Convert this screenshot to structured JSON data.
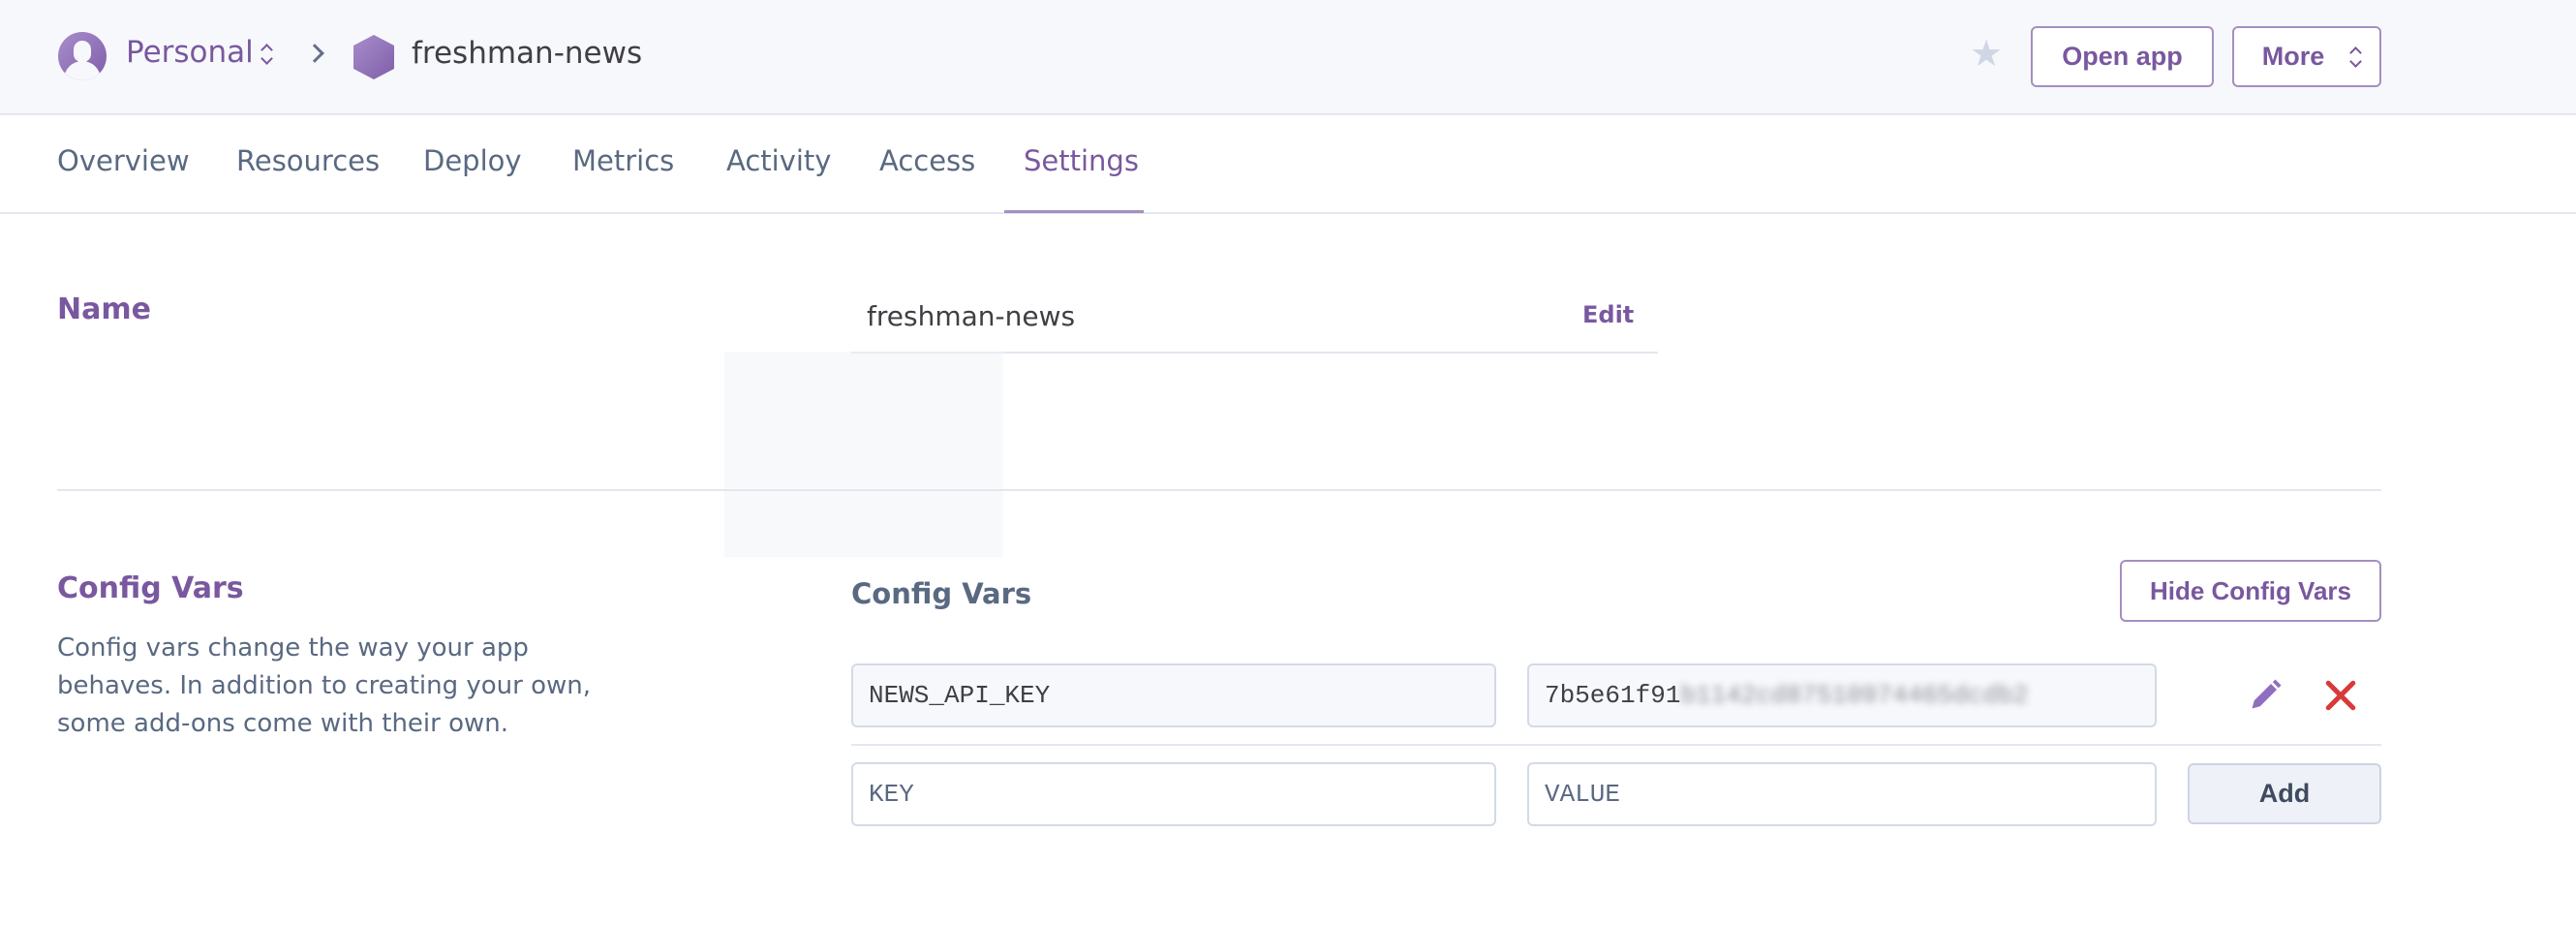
{
  "header": {
    "account_label": "Personal",
    "app_name": "freshman-news",
    "open_app_label": "Open app",
    "more_label": "More"
  },
  "tabs": [
    {
      "label": "Overview",
      "active": false
    },
    {
      "label": "Resources",
      "active": false
    },
    {
      "label": "Deploy",
      "active": false
    },
    {
      "label": "Metrics",
      "active": false
    },
    {
      "label": "Activity",
      "active": false
    },
    {
      "label": "Access",
      "active": false
    },
    {
      "label": "Settings",
      "active": true
    }
  ],
  "name_section": {
    "title": "Name",
    "value": "freshman-news",
    "edit_label": "Edit"
  },
  "config_vars_section": {
    "title": "Config Vars",
    "description": "Config vars change the way your app behaves. In addition to creating your own, some add-ons come with their own.",
    "heading": "Config Vars",
    "hide_button_label": "Hide Config Vars",
    "vars": [
      {
        "key": "NEWS_API_KEY",
        "value_visible": "7b5e61f91",
        "value_redacted": "b1142cd87510974465dcdb2"
      }
    ],
    "new_var": {
      "key_placeholder": "KEY",
      "value_placeholder": "VALUE",
      "add_label": "Add"
    }
  },
  "colors": {
    "brand": "#79589f",
    "delete": "#d83a3a",
    "muted": "#596981"
  }
}
